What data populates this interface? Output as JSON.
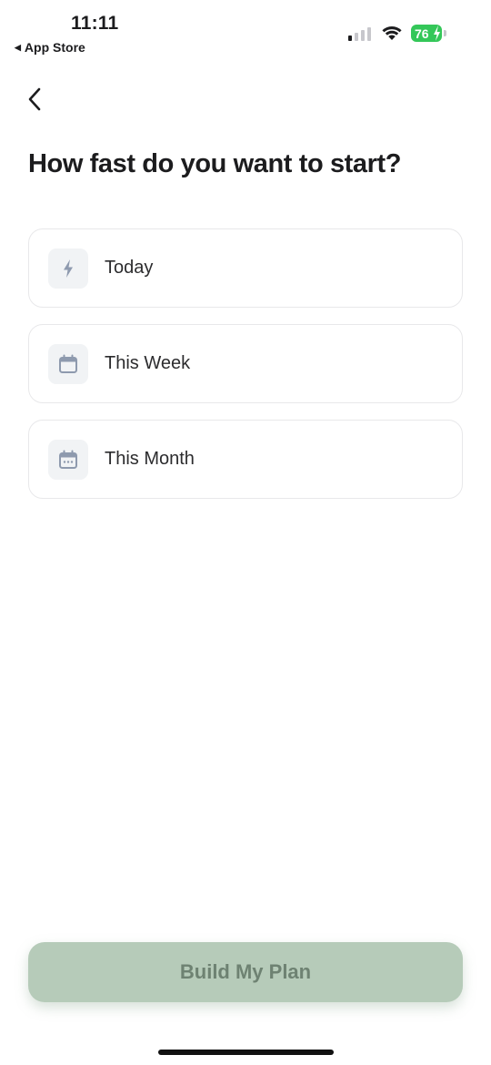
{
  "status_bar": {
    "time": "11:11",
    "back_app": "App Store",
    "battery_level": "76",
    "signal_bars": 1
  },
  "nav": {
    "back_icon": "chevron-left-icon"
  },
  "page": {
    "title": "How fast do you want to start?"
  },
  "options": [
    {
      "icon": "lightning-icon",
      "label": "Today"
    },
    {
      "icon": "calendar-icon",
      "label": "This Week"
    },
    {
      "icon": "calendar-month-icon",
      "label": "This Month"
    }
  ],
  "cta": {
    "label": "Build My Plan",
    "background": "#b6cbb9",
    "text_color": "#6e8272"
  }
}
